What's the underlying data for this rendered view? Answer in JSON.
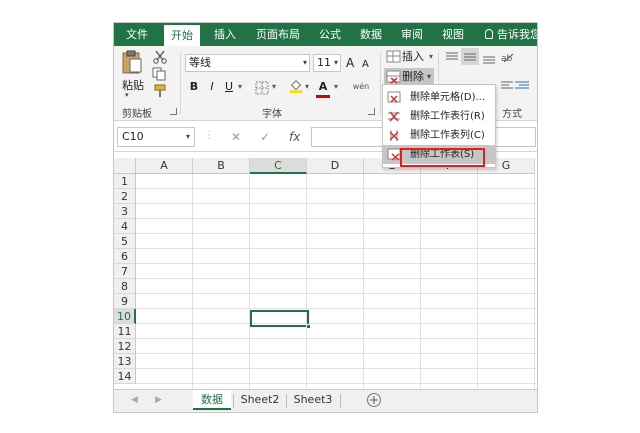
{
  "ribbon_tabs": [
    "文件",
    "开始",
    "插入",
    "页面布局",
    "公式",
    "数据",
    "审阅",
    "视图"
  ],
  "tell_me": "告诉我您",
  "clipboard": {
    "paste": "粘贴",
    "group": "剪贴板"
  },
  "font": {
    "name": "等线",
    "size": "11",
    "grow": "A",
    "shrink": "A",
    "bold": "B",
    "italic": "I",
    "underline": "U",
    "font_color_glyph": "A",
    "wen": "wén",
    "group": "字体"
  },
  "cells_group": {
    "insert": "插入",
    "delete": "删除"
  },
  "alignment_group_partial": "方式",
  "delete_menu": [
    "删除单元格(D)...",
    "删除工作表行(R)",
    "删除工作表列(C)",
    "删除工作表(S)"
  ],
  "namebox": "C10",
  "formula_buttons": {
    "cancel": "✕",
    "enter": "✓",
    "fx": "fx"
  },
  "columns": [
    "A",
    "B",
    "C",
    "D",
    "E",
    "F",
    "G"
  ],
  "rows": [
    "1",
    "2",
    "3",
    "4",
    "5",
    "6",
    "7",
    "8",
    "9",
    "10",
    "11",
    "12",
    "13",
    "14"
  ],
  "selected_column": "C",
  "selected_row": "10",
  "sheets": [
    "数据",
    "Sheet2",
    "Sheet3"
  ],
  "active_sheet": "数据",
  "colors": {
    "excel_green": "#217346",
    "highlight_red": "#e02020",
    "font_red": "#d00000",
    "highlight_yellow": "#ffe000"
  }
}
